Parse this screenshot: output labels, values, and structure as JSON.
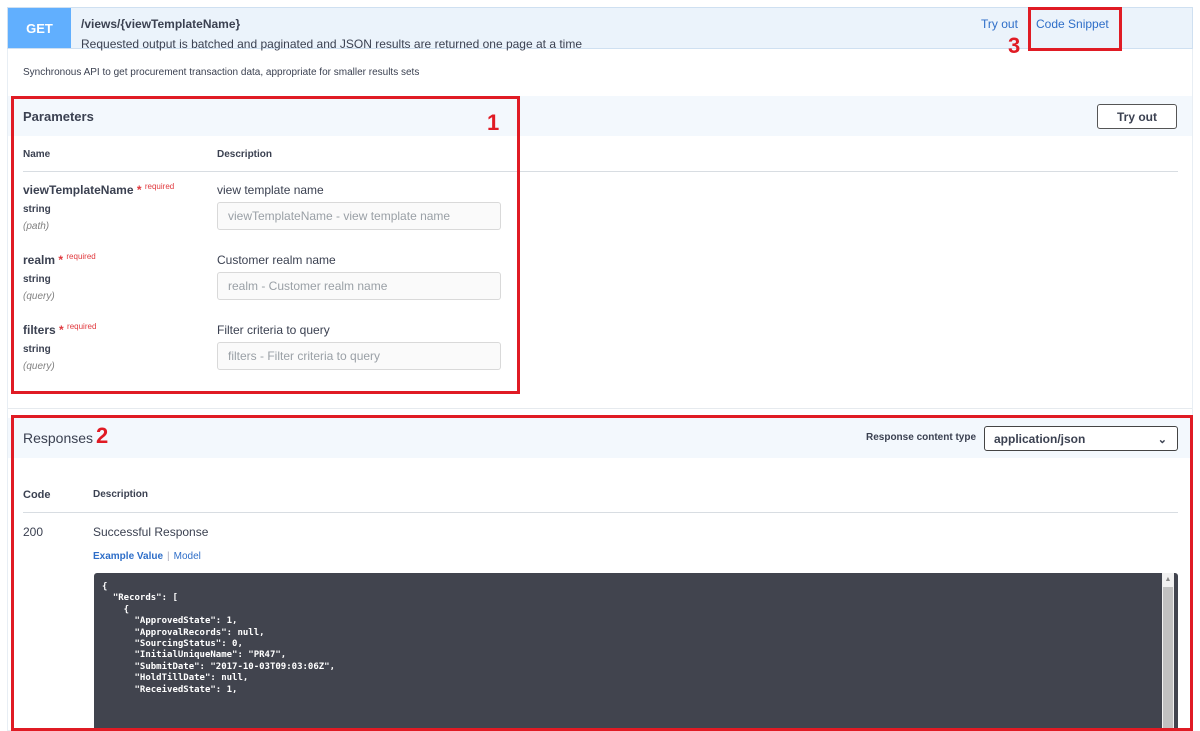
{
  "operation": {
    "method": "GET",
    "path": "/views/{viewTemplateName}",
    "summary": "Requested output is batched and paginated and JSON results are returned one page at a time",
    "try_out_link": "Try out",
    "code_snippet_link": "Code Snippet",
    "description": "Synchronous API to get procurement transaction data, appropriate for smaller results sets"
  },
  "parameters": {
    "title": "Parameters",
    "try_out_button": "Try out",
    "col_name": "Name",
    "col_description": "Description",
    "items": [
      {
        "name": "viewTemplateName",
        "star": "*",
        "required": "required",
        "type": "string",
        "in": "(path)",
        "description": "view template name",
        "placeholder": "viewTemplateName - view template name"
      },
      {
        "name": "realm",
        "star": "*",
        "required": "required",
        "type": "string",
        "in": "(query)",
        "description": "Customer realm name",
        "placeholder": "realm - Customer realm name"
      },
      {
        "name": "filters",
        "star": "*",
        "required": "required",
        "type": "string",
        "in": "(query)",
        "description": "Filter criteria to query",
        "placeholder": "filters - Filter criteria to query"
      }
    ]
  },
  "responses": {
    "title": "Responses",
    "content_type_label": "Response content type",
    "content_type_value": "application/json",
    "col_code": "Code",
    "col_description": "Description",
    "items": [
      {
        "code": "200",
        "description": "Successful Response",
        "example_tab": "Example Value",
        "model_tab": "Model"
      }
    ],
    "example_lines": [
      "{",
      "  \"Records\": [",
      "    {",
      "      \"ApprovedState\": 1,",
      "      \"ApprovalRecords\": null,",
      "      \"SourcingStatus\": 0,",
      "      \"InitialUniqueName\": \"PR47\",",
      "      \"SubmitDate\": \"2017-10-03T09:03:06Z\",",
      "      \"HoldTillDate\": null,",
      "      \"ReceivedState\": 1,"
    ]
  },
  "annotations": {
    "color": "#e01b24",
    "labels": [
      "1",
      "2",
      "3"
    ]
  },
  "colors": {
    "get_method": "#61affe",
    "link": "#2e6ec8",
    "required": "#e0393e",
    "code_bg": "#41444e"
  }
}
